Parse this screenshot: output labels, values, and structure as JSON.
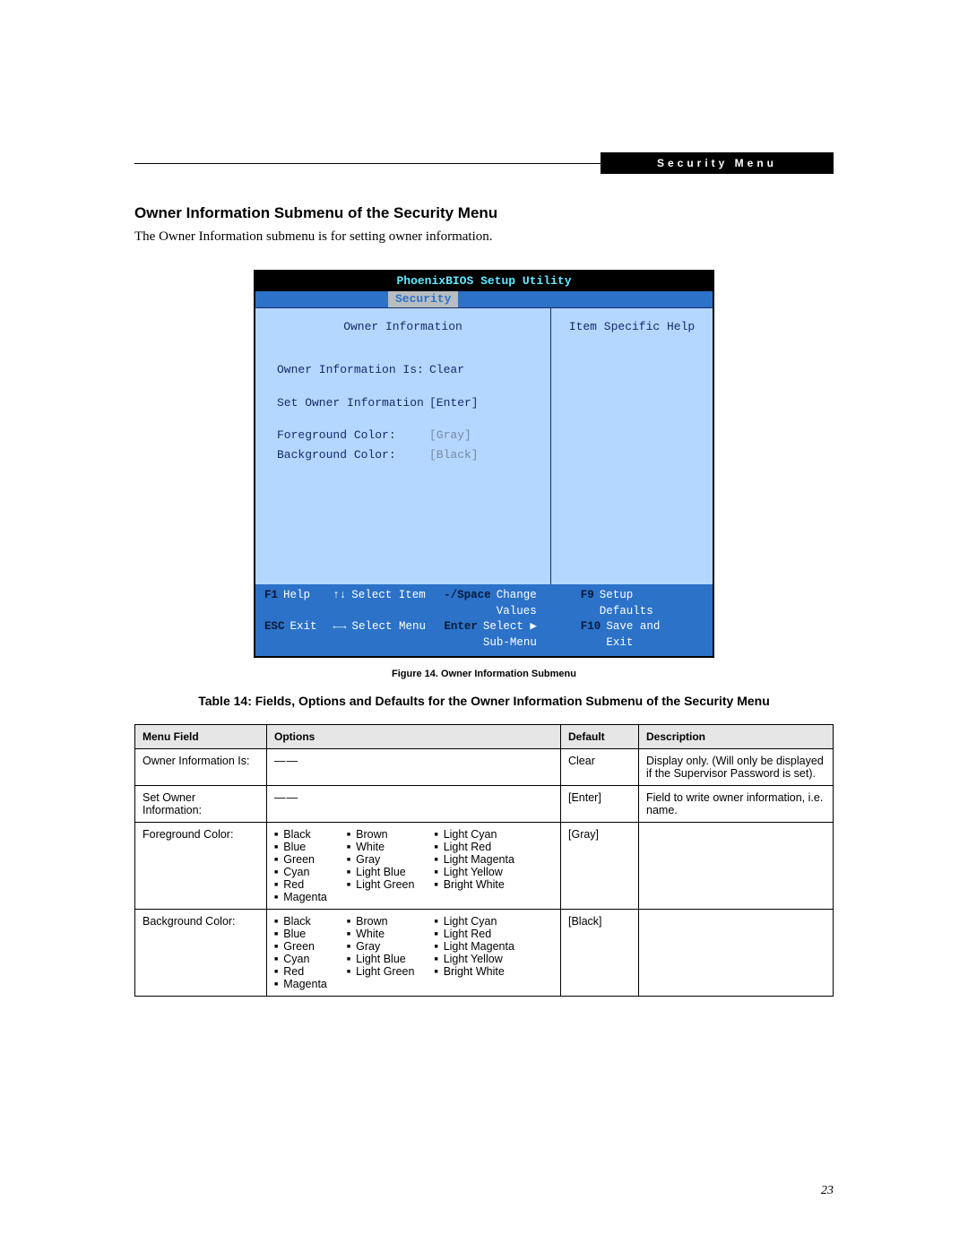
{
  "header": {
    "label": "Security Menu"
  },
  "title": "Owner Information Submenu of the Security Menu",
  "intro": "The Owner Information submenu is for setting owner information.",
  "bios": {
    "title": "PhoenixBIOS Setup Utility",
    "tab": "Security",
    "panel_title": "Owner Information",
    "help_title": "Item Specific Help",
    "rows": [
      {
        "label": "Owner Information Is:",
        "value": "Clear",
        "cls": ""
      },
      {
        "label": "Set Owner Information",
        "value": "[Enter]",
        "cls": ""
      },
      {
        "label": "Foreground Color:",
        "value": "[Gray]",
        "cls": "gray"
      },
      {
        "label": "Background Color:",
        "value": "[Black]",
        "cls": "gray"
      }
    ],
    "footer": {
      "r1": [
        {
          "k": "F1",
          "v": "Help",
          "klit": true
        },
        {
          "k": "↑↓",
          "v": "Select Item",
          "klit": false
        },
        {
          "k": "-/Space",
          "v": "Change Values",
          "klit": true
        },
        {
          "k": "F9",
          "v": "Setup Defaults",
          "klit": true
        }
      ],
      "r2": [
        {
          "k": "ESC",
          "v": "Exit",
          "klit": true
        },
        {
          "k": "←→",
          "v": "Select Menu",
          "klit": false
        },
        {
          "k": "Enter",
          "v": "Select ▶ Sub-Menu",
          "klit": true
        },
        {
          "k": "F10",
          "v": "Save and Exit",
          "klit": true
        }
      ]
    }
  },
  "fig_caption": "Figure 14.   Owner Information Submenu",
  "table_title": "Table 14: Fields, Options and Defaults for the Owner Information Submenu of the Security Menu",
  "table": {
    "headers": [
      "Menu Field",
      "Options",
      "Default",
      "Description"
    ],
    "rows": [
      {
        "field": "Owner Information Is:",
        "options_dash": true,
        "default": "Clear",
        "desc": "Display only. (Will only be displayed if the Supervisor Password is set)."
      },
      {
        "field": "Set Owner\nInformation:",
        "options_dash": true,
        "default": "[Enter]",
        "desc": "Field to write owner information, i.e. name."
      },
      {
        "field": "Foreground Color:",
        "options_cols": [
          [
            "Black",
            "Blue",
            "Green",
            "Cyan",
            "Red",
            "Magenta"
          ],
          [
            "Brown",
            "White",
            "Gray",
            "Light Blue",
            "Light Green"
          ],
          [
            "Light Cyan",
            "Light Red",
            "Light Magenta",
            "Light Yellow",
            "Bright White"
          ]
        ],
        "default": "[Gray]",
        "desc": ""
      },
      {
        "field": "Background Color:",
        "options_cols": [
          [
            "Black",
            "Blue",
            "Green",
            "Cyan",
            "Red",
            "Magenta"
          ],
          [
            "Brown",
            "White",
            "Gray",
            "Light Blue",
            "Light Green"
          ],
          [
            "Light Cyan",
            "Light Red",
            "Light Magenta",
            "Light Yellow",
            "Bright White"
          ]
        ],
        "default": "[Black]",
        "desc": ""
      }
    ]
  },
  "page_number": "23"
}
